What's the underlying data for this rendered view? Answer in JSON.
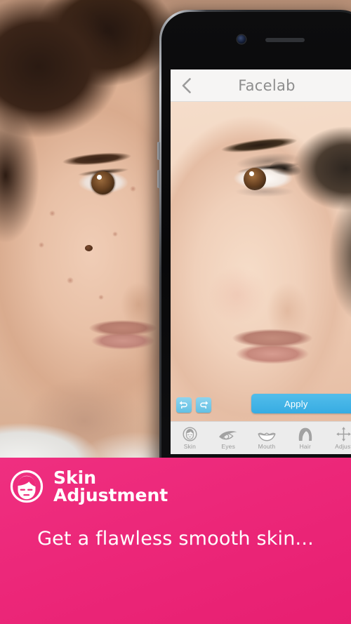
{
  "app": {
    "screen_title": "Facelab",
    "back_icon": "chevron-left-icon"
  },
  "editor": {
    "undo_label": "undo-icon",
    "redo_label": "redo-icon",
    "apply_label": "Apply",
    "tools": [
      {
        "label": "Skin",
        "icon": "face-skin-icon"
      },
      {
        "label": "Eyes",
        "icon": "eye-icon"
      },
      {
        "label": "Mouth",
        "icon": "mouth-icon"
      },
      {
        "label": "Hair",
        "icon": "hair-icon"
      },
      {
        "label": "Adjust",
        "icon": "move-arrows-icon"
      }
    ]
  },
  "banner": {
    "icon": "face-circle-icon",
    "title_line1": "Skin",
    "title_line2": "Adjustment",
    "subtitle": "Get a flawless smooth skin...",
    "background_color": "#ED2A7B",
    "text_color": "#FFFFFF"
  },
  "colors": {
    "accent_blue": "#3CADE4",
    "navbar_bg": "#F6F5F4",
    "navbar_text": "#8D8D8D",
    "toolbar_bg": "#ECECEC",
    "toolbar_text": "#9A9A9A"
  }
}
